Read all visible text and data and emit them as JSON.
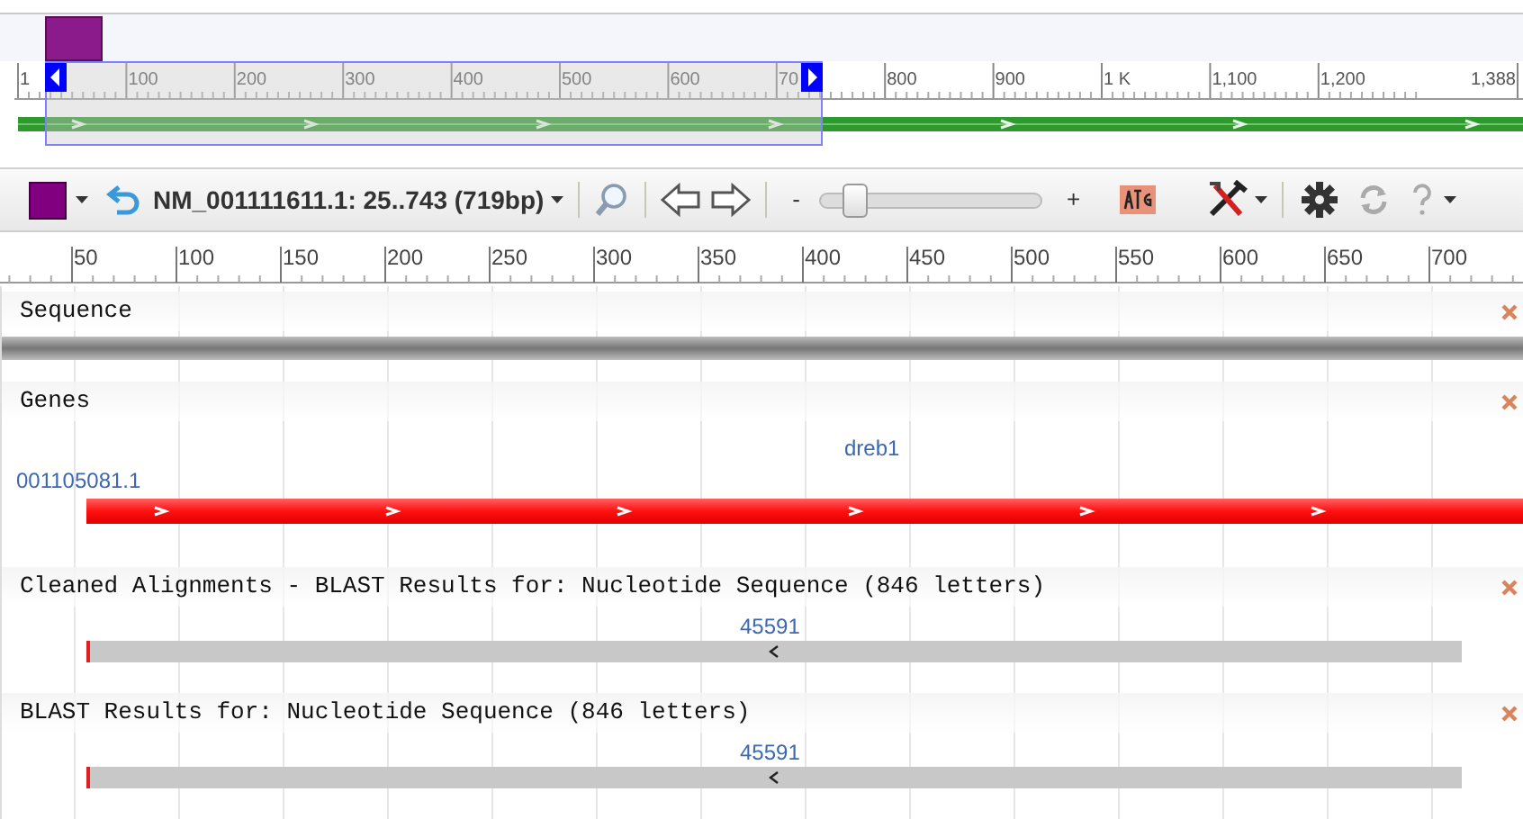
{
  "overview": {
    "ruler_labels": [
      "1",
      "100",
      "200",
      "300",
      "400",
      "500",
      "600",
      "70",
      "800",
      "900",
      "1 K",
      "1,100",
      "1,200",
      "1,388"
    ]
  },
  "toolbar": {
    "location": "NM_001111611.1: 25..743 (719bp)",
    "zoom_minus": "-",
    "zoom_plus": "+",
    "zoom_level": {
      "level": 0.12
    }
  },
  "ruler": {
    "labels": [
      "50",
      "100",
      "150",
      "200",
      "250",
      "300",
      "350",
      "400",
      "450",
      "500",
      "550",
      "600",
      "650",
      "700"
    ]
  },
  "tracks": [
    {
      "kind": "sequence",
      "title": "Sequence"
    },
    {
      "kind": "genes",
      "title": "Genes",
      "gene_label": "dreb1",
      "transcript_label": "001105081.1"
    },
    {
      "kind": "alignment",
      "title": "Cleaned Alignments - BLAST Results for: Nucleotide Sequence (846 letters)",
      "hit_label": "45591"
    },
    {
      "kind": "alignment",
      "title": "BLAST Results for: Nucleotide Sequence (846 letters)",
      "hit_label": "45591"
    }
  ]
}
